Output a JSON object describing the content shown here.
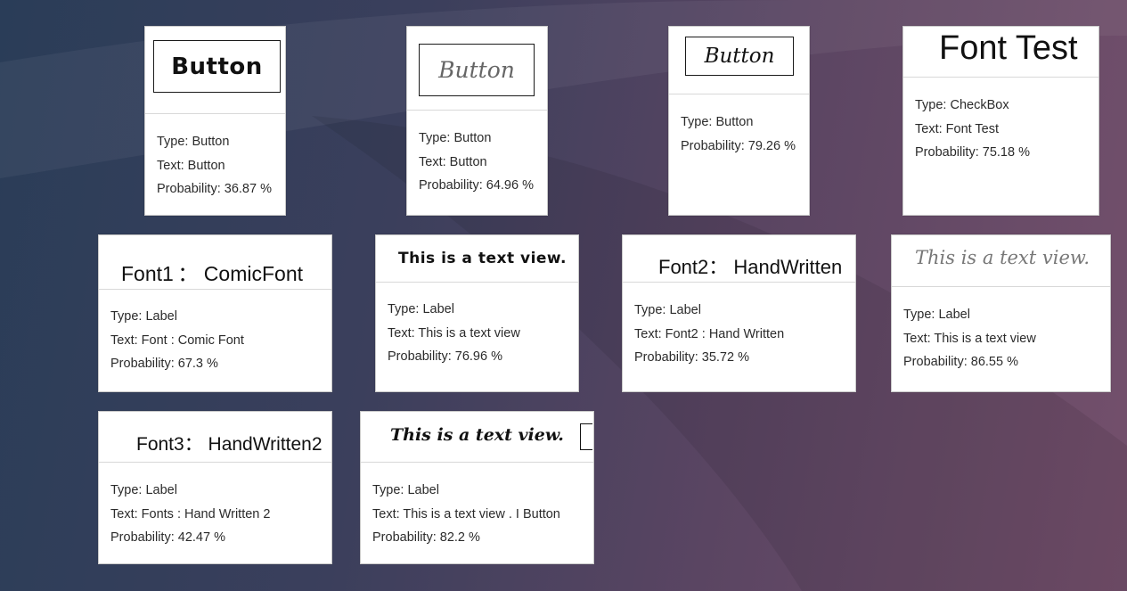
{
  "colors": {
    "card_bg": "#ffffff",
    "text": "#2b2b2b",
    "bg_start": "#2a3d58",
    "bg_end": "#74506c"
  },
  "cards": [
    {
      "sample": "Button",
      "lines": [
        "Type: Button",
        "Text: Button",
        "Probability: 36.87 %"
      ]
    },
    {
      "sample": "Button",
      "lines": [
        "Type: Button",
        "Text: Button",
        "Probability: 64.96 %"
      ]
    },
    {
      "sample": "Button",
      "lines": [
        "Type: Button",
        "Probability: 79.26 %"
      ]
    },
    {
      "sample": "Font Test",
      "lines": [
        "Type: CheckBox",
        "Text: Font Test",
        "Probability: 75.18 %"
      ]
    },
    {
      "sample": "Font1 ： ComicFont",
      "lines": [
        "Type: Label",
        "Text: Font : Comic Font",
        "Probability: 67.3 %"
      ]
    },
    {
      "sample": "This is a text view.",
      "lines": [
        "Type: Label",
        "Text: This is a text view",
        "Probability: 76.96 %"
      ]
    },
    {
      "sample": "Font2： HandWritten",
      "lines": [
        "Type: Label",
        "Text: Font2 : Hand Written",
        "Probability: 35.72 %"
      ]
    },
    {
      "sample": "This is a text view.",
      "lines": [
        "Type: Label",
        "Text: This is a text view",
        "Probability: 86.55 %"
      ]
    },
    {
      "sample": "Font3： HandWritten2",
      "lines": [
        "Type: Label",
        "Text: Fonts : Hand Written 2",
        "Probability: 42.47 %"
      ]
    },
    {
      "sample": "This is a text view.",
      "lines": [
        "Type: Label",
        "Text: This is a text view . I Button",
        "Probability: 82.2 %"
      ]
    }
  ]
}
